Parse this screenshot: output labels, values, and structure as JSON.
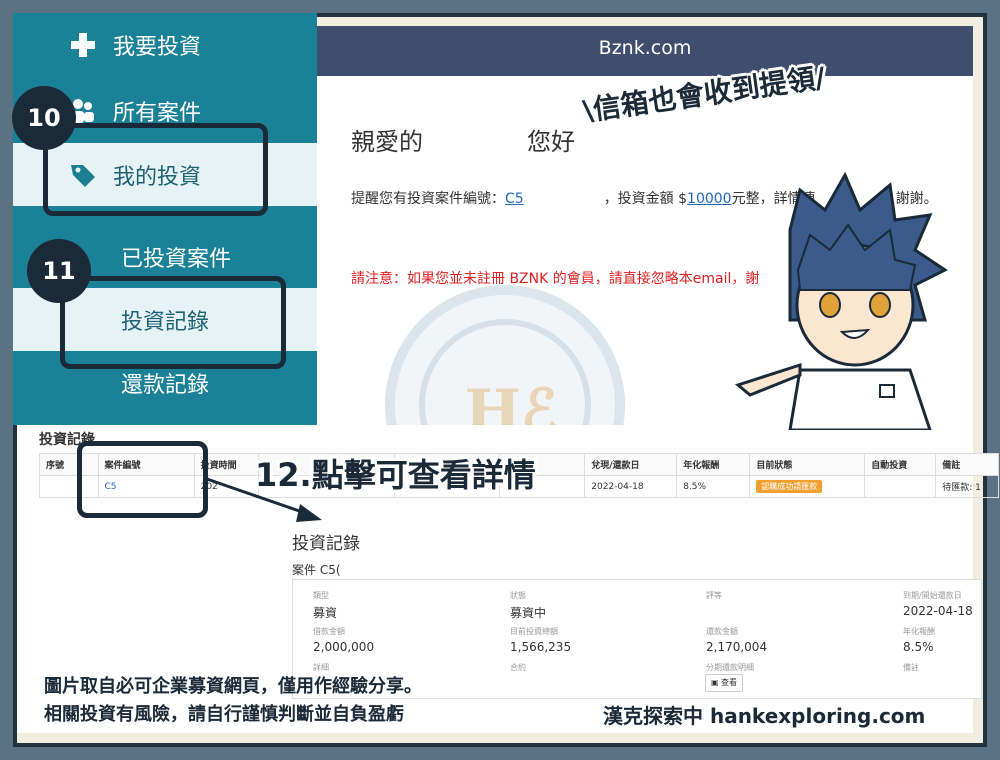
{
  "sidebar": {
    "items": [
      {
        "label": "我要投資",
        "icon": "plus-icon"
      },
      {
        "label": "所有案件",
        "icon": "users-icon"
      },
      {
        "label": "我的投資",
        "icon": "tag-icon"
      },
      {
        "label": "已投資案件",
        "icon": ""
      },
      {
        "label": "投資記錄",
        "icon": ""
      },
      {
        "label": "還款記錄",
        "icon": ""
      }
    ]
  },
  "email": {
    "header": "Bznk.com",
    "greeting": "親愛的",
    "hello": "您好",
    "reminder_prefix": "提醒您有投資案件編號：",
    "case_no": "C5",
    "reminder_mid": "，投資金額 $",
    "amount": "10000",
    "reminder_suffix": "元整，詳情連",
    "reminder_thanks": "謝謝。",
    "warning": "請注意：如果您並未註冊 BZNK 的會員，請直接忽略本email，謝"
  },
  "watermark": "Hℰ",
  "table": {
    "title": "投資記錄",
    "columns": [
      "序號",
      "案件編號",
      "投資時間",
      "",
      "",
      "",
      "兌現/還款日",
      "年化報酬",
      "目前狀態",
      "自動投資",
      "備註"
    ],
    "row": {
      "no": "",
      "case": "C5",
      "time": "202",
      "date": "2022-04-18",
      "rate": "8.5%",
      "status": "認購成功請匯款",
      "auto": "",
      "note": "待匯款: 1"
    }
  },
  "detail": {
    "title": "投資記錄",
    "case_label": "案件 C5(",
    "fields": [
      {
        "label": "類型",
        "value": "募資"
      },
      {
        "label": "狀態",
        "value": "募資中"
      },
      {
        "label": "評等",
        "value": ""
      },
      {
        "label": "到期/開始還款日",
        "value": "2022-04-18"
      },
      {
        "label": "借款金額",
        "value": "2,000,000"
      },
      {
        "label": "目前投資總額",
        "value": "1,566,235"
      },
      {
        "label": "還款金額",
        "value": "2,170,004"
      },
      {
        "label": "年化報酬",
        "value": "8.5%"
      },
      {
        "label": "詳細",
        "value": ""
      },
      {
        "label": "合約",
        "value": ""
      },
      {
        "label": "分期還款明細",
        "value": ""
      },
      {
        "label": "備註",
        "value": ""
      }
    ],
    "view_button": "查看"
  },
  "annotations": {
    "step10": "10",
    "step11": "11",
    "email_note": "\\信箱也會收到提領/",
    "click_note": "12.點擊可查看詳情"
  },
  "footer": {
    "line1": "圖片取自必可企業募資網頁，僅用作經驗分享。",
    "line2": "相關投資有風險，請自行謹慎判斷並自負盈虧",
    "brand": "漢克探索中 hankexploring.com"
  },
  "colors": {
    "sidebar": "#1b8196",
    "header": "#3f4e6c",
    "outline": "#1b2a38",
    "warning": "#dd2222",
    "frame": "#5a7283"
  }
}
